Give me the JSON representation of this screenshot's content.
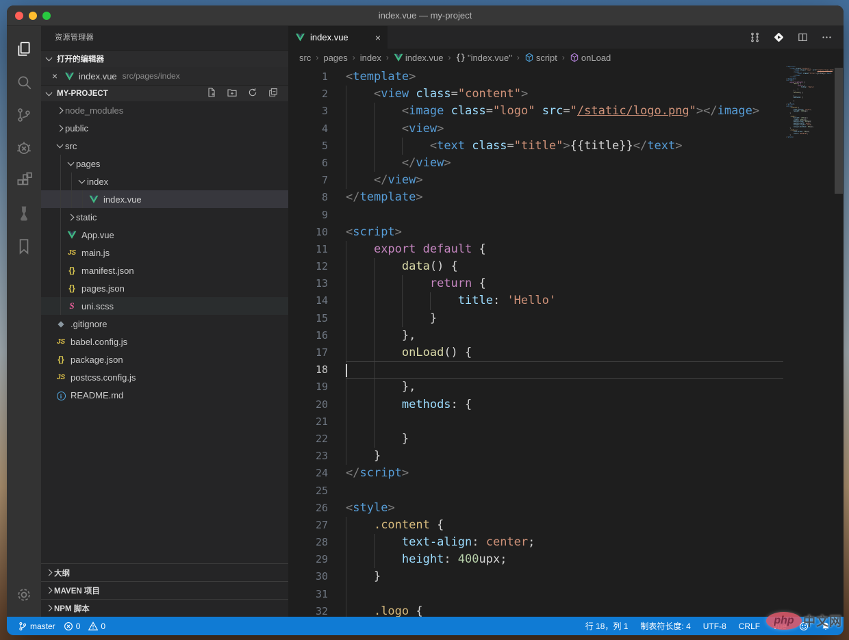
{
  "window": {
    "title": "index.vue — my-project"
  },
  "colors": {
    "statusbar_accent": "#107bd4",
    "vue_green": "#41b883",
    "editor_bg": "#1e1e1e",
    "sidebar_bg": "#252526",
    "activitybar_bg": "#333333",
    "titlebar_bg": "#373737",
    "tree_selection": "#37373d",
    "string_orange": "#ce9178",
    "keyword_purple": "#c586c0",
    "tag_blue": "#569cd6",
    "function_yellow": "#dcdcaa"
  },
  "activity_bar": {
    "items": [
      "explorer-icon",
      "search-icon",
      "source-control-icon",
      "debug-icon",
      "extensions-icon",
      "test-beaker-icon",
      "bookmarks-icon"
    ],
    "bottom": [
      "settings-gear-icon"
    ]
  },
  "sidebar": {
    "title": "资源管理器",
    "open_editors": {
      "label": "打开的编辑器",
      "file": "index.vue",
      "path": "src/pages/index"
    },
    "project": {
      "label": "MY-PROJECT",
      "actions": [
        "new-file-icon",
        "new-folder-icon",
        "refresh-icon",
        "collapse-all-icon"
      ]
    },
    "tree": [
      {
        "label": "node_modules",
        "level": 0,
        "kind": "folder",
        "state": "collapsed",
        "dim": true
      },
      {
        "label": "public",
        "level": 0,
        "kind": "folder",
        "state": "collapsed"
      },
      {
        "label": "src",
        "level": 0,
        "kind": "folder",
        "state": "expanded"
      },
      {
        "label": "pages",
        "level": 1,
        "kind": "folder",
        "state": "expanded"
      },
      {
        "label": "index",
        "level": 2,
        "kind": "folder",
        "state": "expanded"
      },
      {
        "label": "index.vue",
        "level": 3,
        "kind": "file",
        "icon": "vue",
        "selected": true
      },
      {
        "label": "static",
        "level": 1,
        "kind": "folder",
        "state": "collapsed"
      },
      {
        "label": "App.vue",
        "level": 1,
        "kind": "file",
        "icon": "vue"
      },
      {
        "label": "main.js",
        "level": 1,
        "kind": "file",
        "icon": "js"
      },
      {
        "label": "manifest.json",
        "level": 1,
        "kind": "file",
        "icon": "json"
      },
      {
        "label": "pages.json",
        "level": 1,
        "kind": "file",
        "icon": "json"
      },
      {
        "label": "uni.scss",
        "level": 1,
        "kind": "file",
        "icon": "sass",
        "subtle": true
      },
      {
        "label": ".gitignore",
        "level": 0,
        "kind": "file",
        "icon": "git"
      },
      {
        "label": "babel.config.js",
        "level": 0,
        "kind": "file",
        "icon": "js"
      },
      {
        "label": "package.json",
        "level": 0,
        "kind": "file",
        "icon": "json"
      },
      {
        "label": "postcss.config.js",
        "level": 0,
        "kind": "file",
        "icon": "js"
      },
      {
        "label": "README.md",
        "level": 0,
        "kind": "file",
        "icon": "info"
      }
    ],
    "panels": [
      "大纲",
      "MAVEN 项目",
      "NPM 脚本"
    ]
  },
  "editor": {
    "tab": {
      "label": "index.vue"
    },
    "actions": [
      "open-changes-icon",
      "run-code-icon",
      "split-editor-icon",
      "more-actions-icon"
    ],
    "breadcrumbs": [
      {
        "label": "src"
      },
      {
        "label": "pages"
      },
      {
        "label": "index"
      },
      {
        "icon": "vue",
        "label": "index.vue"
      },
      {
        "icon": "braces",
        "label": "\"index.vue\""
      },
      {
        "icon": "module-blue",
        "label": "script"
      },
      {
        "icon": "module-purple",
        "label": "onLoad"
      }
    ],
    "code": {
      "active_line": 18,
      "lines": [
        {
          "n": 1,
          "segs": [
            [
              "p",
              "<"
            ],
            [
              "tag",
              "template"
            ],
            [
              "p",
              ">"
            ]
          ]
        },
        {
          "n": 2,
          "segs": [
            [
              "w",
              "    "
            ],
            [
              "p",
              "<"
            ],
            [
              "tag",
              "view"
            ],
            [
              "w",
              " "
            ],
            [
              "attr",
              "class"
            ],
            [
              "w",
              "="
            ],
            [
              "str",
              "\"content\""
            ],
            [
              "p",
              ">"
            ]
          ]
        },
        {
          "n": 3,
          "segs": [
            [
              "w",
              "        "
            ],
            [
              "p",
              "<"
            ],
            [
              "tag",
              "image"
            ],
            [
              "w",
              " "
            ],
            [
              "attr",
              "class"
            ],
            [
              "w",
              "="
            ],
            [
              "str",
              "\"logo\""
            ],
            [
              "w",
              " "
            ],
            [
              "attr",
              "src"
            ],
            [
              "w",
              "="
            ],
            [
              "str",
              "\""
            ],
            [
              "strU",
              "/static/logo.png"
            ],
            [
              "str",
              "\""
            ],
            [
              "p",
              "><"
            ],
            [
              "p",
              "/"
            ],
            [
              "tag",
              "image"
            ],
            [
              "p",
              ">"
            ]
          ]
        },
        {
          "n": 4,
          "segs": [
            [
              "w",
              "        "
            ],
            [
              "p",
              "<"
            ],
            [
              "tag",
              "view"
            ],
            [
              "p",
              ">"
            ]
          ]
        },
        {
          "n": 5,
          "segs": [
            [
              "w",
              "            "
            ],
            [
              "p",
              "<"
            ],
            [
              "tag",
              "text"
            ],
            [
              "w",
              " "
            ],
            [
              "attr",
              "class"
            ],
            [
              "w",
              "="
            ],
            [
              "str",
              "\"title\""
            ],
            [
              "p",
              ">"
            ],
            [
              "w",
              "{{title}}"
            ],
            [
              "p",
              "</"
            ],
            [
              "tag",
              "text"
            ],
            [
              "p",
              ">"
            ]
          ]
        },
        {
          "n": 6,
          "segs": [
            [
              "w",
              "        "
            ],
            [
              "p",
              "</"
            ],
            [
              "tag",
              "view"
            ],
            [
              "p",
              ">"
            ]
          ]
        },
        {
          "n": 7,
          "segs": [
            [
              "w",
              "    "
            ],
            [
              "p",
              "</"
            ],
            [
              "tag",
              "view"
            ],
            [
              "p",
              ">"
            ]
          ]
        },
        {
          "n": 8,
          "segs": [
            [
              "p",
              "</"
            ],
            [
              "tag",
              "template"
            ],
            [
              "p",
              ">"
            ]
          ]
        },
        {
          "n": 9,
          "segs": []
        },
        {
          "n": 10,
          "segs": [
            [
              "p",
              "<"
            ],
            [
              "tag",
              "script"
            ],
            [
              "p",
              ">"
            ]
          ]
        },
        {
          "n": 11,
          "segs": [
            [
              "w",
              "    "
            ],
            [
              "kw",
              "export"
            ],
            [
              "w",
              " "
            ],
            [
              "kw",
              "default"
            ],
            [
              "w",
              " {"
            ]
          ]
        },
        {
          "n": 12,
          "segs": [
            [
              "w",
              "        "
            ],
            [
              "fn",
              "data"
            ],
            [
              "w",
              "() {"
            ]
          ]
        },
        {
          "n": 13,
          "segs": [
            [
              "w",
              "            "
            ],
            [
              "kw",
              "return"
            ],
            [
              "w",
              " {"
            ]
          ]
        },
        {
          "n": 14,
          "segs": [
            [
              "w",
              "                "
            ],
            [
              "prop",
              "title"
            ],
            [
              "w",
              ": "
            ],
            [
              "str",
              "'Hello'"
            ]
          ]
        },
        {
          "n": 15,
          "segs": [
            [
              "w",
              "            }"
            ]
          ]
        },
        {
          "n": 16,
          "segs": [
            [
              "w",
              "        },"
            ]
          ]
        },
        {
          "n": 17,
          "segs": [
            [
              "w",
              "        "
            ],
            [
              "fn",
              "onLoad"
            ],
            [
              "w",
              "() {"
            ]
          ]
        },
        {
          "n": 18,
          "segs": [
            [
              "w",
              "        "
            ]
          ]
        },
        {
          "n": 19,
          "segs": [
            [
              "w",
              "        },"
            ]
          ]
        },
        {
          "n": 20,
          "segs": [
            [
              "w",
              "        "
            ],
            [
              "prop",
              "methods"
            ],
            [
              "w",
              ": {"
            ]
          ]
        },
        {
          "n": 21,
          "segs": [
            [
              "w",
              "        "
            ]
          ]
        },
        {
          "n": 22,
          "segs": [
            [
              "w",
              "        }"
            ]
          ]
        },
        {
          "n": 23,
          "segs": [
            [
              "w",
              "    }"
            ]
          ]
        },
        {
          "n": 24,
          "segs": [
            [
              "p",
              "</"
            ],
            [
              "tag",
              "script"
            ],
            [
              "p",
              ">"
            ]
          ]
        },
        {
          "n": 25,
          "segs": []
        },
        {
          "n": 26,
          "segs": [
            [
              "p",
              "<"
            ],
            [
              "tag",
              "style"
            ],
            [
              "p",
              ">"
            ]
          ]
        },
        {
          "n": 27,
          "segs": [
            [
              "w",
              "    "
            ],
            [
              "sel",
              ".content"
            ],
            [
              "w",
              " {"
            ]
          ]
        },
        {
          "n": 28,
          "segs": [
            [
              "w",
              "        "
            ],
            [
              "prop",
              "text-align"
            ],
            [
              "w",
              ": "
            ],
            [
              "str",
              "center"
            ],
            [
              "w",
              ";"
            ]
          ]
        },
        {
          "n": 29,
          "segs": [
            [
              "w",
              "        "
            ],
            [
              "prop",
              "height"
            ],
            [
              "w",
              ": "
            ],
            [
              "num",
              "400"
            ],
            [
              "w",
              "upx;"
            ]
          ]
        },
        {
          "n": 30,
          "segs": [
            [
              "w",
              "    }"
            ]
          ]
        },
        {
          "n": 31,
          "segs": [
            [
              "w",
              "    "
            ]
          ]
        },
        {
          "n": 32,
          "segs": [
            [
              "w",
              "    "
            ],
            [
              "sel",
              ".logo"
            ],
            [
              "w",
              " {"
            ]
          ]
        }
      ],
      "minimap_extra": [
        {
          "segs": [
            [
              "w",
              "        "
            ],
            [
              "prop",
              "height"
            ],
            [
              "w",
              ": "
            ],
            [
              "num",
              "200"
            ],
            [
              "w",
              "upx;"
            ]
          ]
        },
        {
          "segs": [
            [
              "w",
              "        "
            ],
            [
              "prop",
              "width"
            ],
            [
              "w",
              ": "
            ],
            [
              "num",
              "200"
            ],
            [
              "w",
              "upx;"
            ]
          ]
        },
        {
          "segs": [
            [
              "w",
              "        "
            ],
            [
              "prop",
              "margin-top"
            ],
            [
              "w",
              ": "
            ],
            [
              "num",
              "200"
            ],
            [
              "w",
              "upx;"
            ]
          ]
        },
        {
          "segs": [
            [
              "w",
              "        "
            ],
            [
              "prop",
              "margin-left"
            ],
            [
              "w",
              ": "
            ],
            [
              "str",
              "auto"
            ],
            [
              "w",
              ";"
            ]
          ]
        },
        {
          "segs": [
            [
              "w",
              "        "
            ],
            [
              "prop",
              "margin-right"
            ],
            [
              "w",
              ": "
            ],
            [
              "str",
              "auto"
            ],
            [
              "w",
              ";"
            ]
          ]
        },
        {
          "segs": [
            [
              "w",
              "        "
            ],
            [
              "prop",
              "margin-bottom"
            ],
            [
              "w",
              ": "
            ],
            [
              "num",
              "50"
            ],
            [
              "w",
              "upx;"
            ]
          ]
        },
        {
          "segs": [
            [
              "w",
              "    }"
            ]
          ]
        },
        {
          "segs": []
        },
        {
          "segs": [
            [
              "w",
              "    "
            ],
            [
              "sel",
              ".title"
            ],
            [
              "w",
              " {"
            ]
          ]
        },
        {
          "segs": [
            [
              "w",
              "        "
            ],
            [
              "prop",
              "font-size"
            ],
            [
              "w",
              ": "
            ],
            [
              "num",
              "36"
            ],
            [
              "w",
              "upx;"
            ]
          ]
        },
        {
          "segs": [
            [
              "w",
              "        "
            ],
            [
              "prop",
              "color"
            ],
            [
              "w",
              ": "
            ],
            [
              "str",
              "#8f8f94"
            ],
            [
              "w",
              ";"
            ]
          ]
        },
        {
          "segs": [
            [
              "w",
              "    }"
            ]
          ]
        },
        {
          "segs": [
            [
              "p",
              "</"
            ],
            [
              "tag",
              "style"
            ],
            [
              "p",
              ">"
            ]
          ]
        }
      ]
    }
  },
  "status_bar": {
    "left": [
      {
        "name": "git-branch",
        "icon": "branch",
        "label": "master"
      },
      {
        "name": "problems-errors",
        "icon": "error",
        "label": "0"
      },
      {
        "name": "problems-warnings",
        "icon": "warning",
        "label": "0"
      }
    ],
    "right": [
      {
        "name": "cursor-position",
        "label": "行 18，列 1"
      },
      {
        "name": "indentation",
        "label": "制表符长度: 4"
      },
      {
        "name": "encoding",
        "label": "UTF-8"
      },
      {
        "name": "eol",
        "label": "CRLF"
      },
      {
        "name": "language-mode",
        "label": "Vue"
      },
      {
        "name": "feedback-smiley",
        "icon": "smiley"
      },
      {
        "name": "notifications-bell",
        "icon": "bell"
      }
    ]
  },
  "watermark": {
    "php": "php",
    "cn": "中文网"
  }
}
